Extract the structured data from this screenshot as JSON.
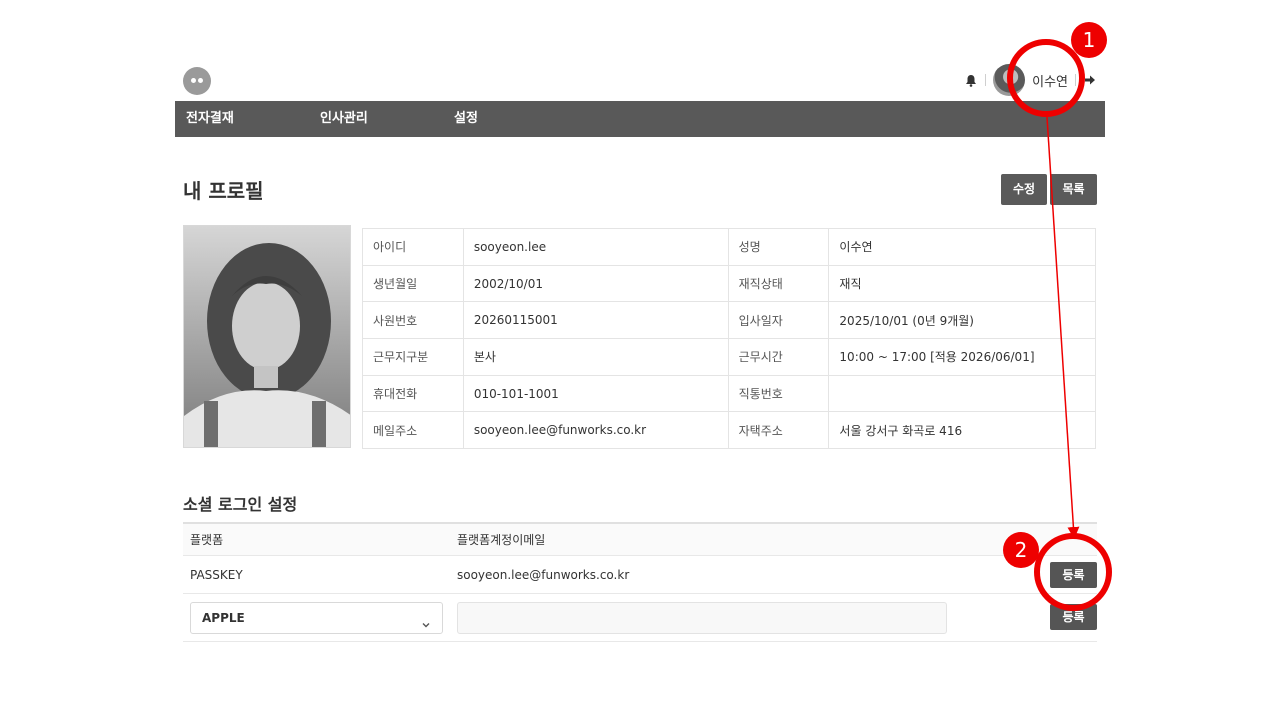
{
  "header": {
    "logo_icon": "ghost-logo-icon",
    "user_name": "이수연",
    "bell_icon": "bell-icon",
    "logout_icon": "logout-arrow-icon"
  },
  "nav": {
    "items": [
      "전자결재",
      "인사관리",
      "설정"
    ]
  },
  "page": {
    "title": "내 프로필",
    "edit_label": "수정",
    "list_label": "목록"
  },
  "profile": {
    "rows": [
      {
        "label1": "아이디",
        "value1": "sooyeon.lee",
        "label2": "성명",
        "value2": "이수연"
      },
      {
        "label1": "생년월일",
        "value1": "2002/10/01",
        "label2": "재직상태",
        "value2": "재직"
      },
      {
        "label1": "사원번호",
        "value1": "20260115001",
        "label2": "입사일자",
        "value2": "2025/10/01 (0년 9개월)"
      },
      {
        "label1": "근무지구분",
        "value1": "본사",
        "label2": "근무시간",
        "value2": "10:00 ~ 17:00 [적용 2026/06/01]"
      },
      {
        "label1": "휴대전화",
        "value1": "010-101-1001",
        "label2": "직통번호",
        "value2": ""
      },
      {
        "label1": "메일주소",
        "value1": "sooyeon.lee@funworks.co.kr",
        "label2": "자택주소",
        "value2": "서울 강서구 화곡로 416"
      }
    ]
  },
  "social": {
    "title": "소셜 로그인 설정",
    "col_platform": "플랫폼",
    "col_email": "플랫폼계정이메일",
    "row1": {
      "platform": "PASSKEY",
      "email": "sooyeon.lee@funworks.co.kr",
      "button": "등록"
    },
    "row2": {
      "platform_selected": "APPLE",
      "email_value": "",
      "button": "등록"
    }
  },
  "annotations": {
    "badge1": "1",
    "badge2": "2",
    "color": "#ee0000"
  },
  "colors": {
    "nav_bg": "#595959",
    "button_bg": "#5a5a5a"
  }
}
